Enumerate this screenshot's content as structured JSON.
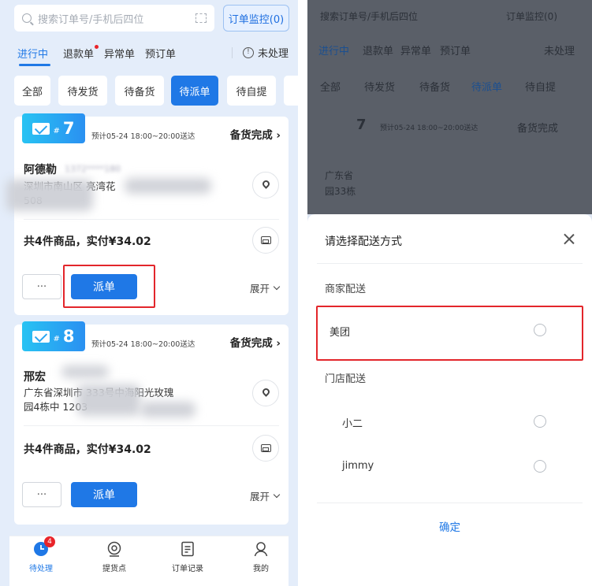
{
  "left": {
    "search": {
      "placeholder": "搜索订单号/手机后四位"
    },
    "monitor_button": "订单监控(0)",
    "tabs": [
      "进行中",
      "退款单",
      "异常单",
      "预订单"
    ],
    "unprocessed": "未处理",
    "filters": [
      "全部",
      "待发货",
      "待备货",
      "待派单",
      "待自提"
    ],
    "active_filter": "待派单",
    "orders": [
      {
        "number": "7",
        "hash": "#",
        "eta": "预计05-24 18:00~20:00送达",
        "status": "备货完成",
        "customer": "阿德勒",
        "phone": "1372****180",
        "address_line1": "深圳市南山区                  亮湾花",
        "address_line2": "              508",
        "total": "共4件商品，实付¥34.02",
        "more": "···",
        "dispatch": "派单",
        "expand": "展开"
      },
      {
        "number": "8",
        "hash": "#",
        "eta": "预计05-24 18:00~20:00送达",
        "status": "备货完成",
        "customer": "邢宏",
        "phone": "",
        "address_line1": "广东省深圳市           333号中海阳光玫瑰",
        "address_line2": "园4栋中                  1203",
        "total": "共4件商品，实付¥34.02",
        "more": "···",
        "dispatch": "派单",
        "expand": "展开"
      }
    ],
    "bottom_nav": [
      {
        "label": "待处理",
        "badge": "4",
        "icon": "clock-icon"
      },
      {
        "label": "提货点",
        "icon": "pickup-point-icon"
      },
      {
        "label": "订单记录",
        "icon": "order-record-icon"
      },
      {
        "label": "我的",
        "icon": "profile-icon"
      }
    ]
  },
  "right": {
    "background": {
      "search": "搜索订单号/手机后四位",
      "monitor_button": "订单监控(0)",
      "tabs": [
        "进行中",
        "退款单",
        "异常单",
        "预订单"
      ],
      "unprocessed": "未处理",
      "filters": [
        "全部",
        "待发货",
        "待备货",
        "待派单",
        "待自提"
      ],
      "order_number": "7",
      "eta": "预计05-24 18:00~20:00送达",
      "status": "备货完成",
      "address_line1": "广东省",
      "address_line2": "园33栋"
    },
    "sheet": {
      "title": "请选择配送方式",
      "merchant_section": "商家配送",
      "merchant_options": [
        "美团"
      ],
      "store_section": "门店配送",
      "store_options": [
        "小二",
        "jimmy"
      ],
      "confirm": "确定"
    }
  },
  "colors": {
    "accent": "#1f78e6",
    "highlight": "#e3262b",
    "badge": "#2aa6f2"
  }
}
